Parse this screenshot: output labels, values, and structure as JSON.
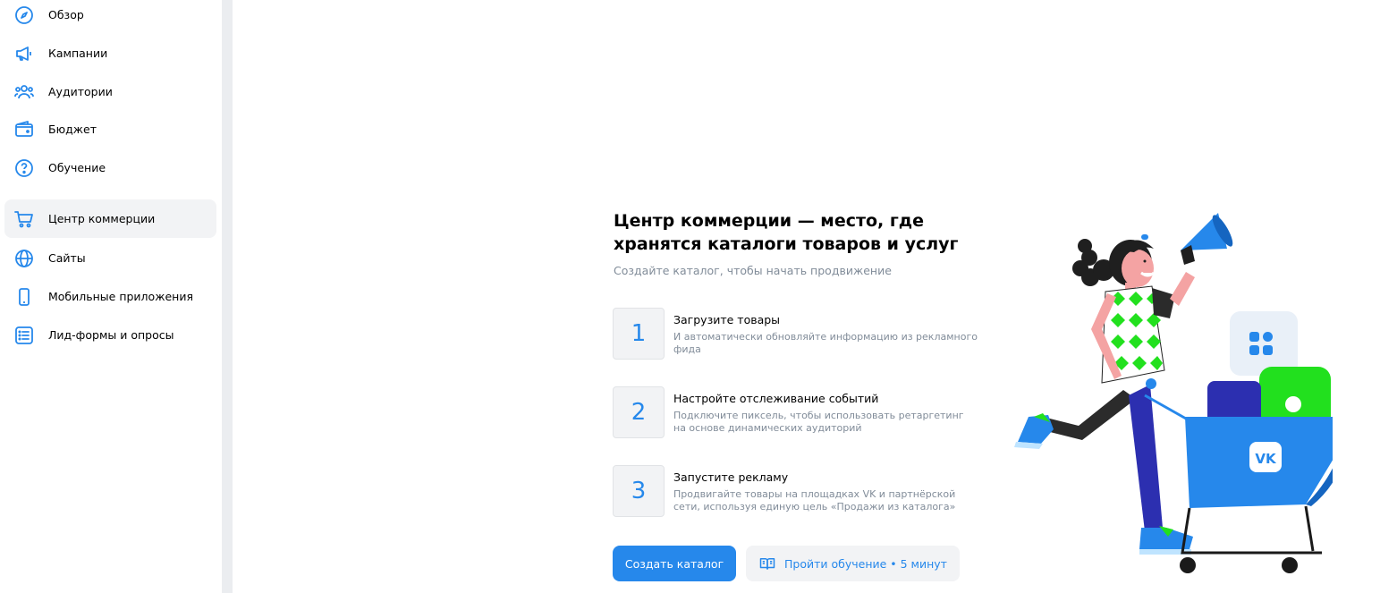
{
  "sidebar": {
    "items": [
      {
        "label": "Обзор",
        "icon": "compass-icon"
      },
      {
        "label": "Кампании",
        "icon": "megaphone-icon"
      },
      {
        "label": "Аудитории",
        "icon": "users-icon"
      },
      {
        "label": "Бюджет",
        "icon": "wallet-icon"
      },
      {
        "label": "Обучение",
        "icon": "question-icon"
      },
      {
        "label": "Центр коммерции",
        "icon": "cart-icon",
        "active": true
      },
      {
        "label": "Сайты",
        "icon": "globe-icon"
      },
      {
        "label": "Мобильные приложения",
        "icon": "phone-icon"
      },
      {
        "label": "Лид-формы и опросы",
        "icon": "list-icon"
      }
    ]
  },
  "main": {
    "headline": "Центр коммерции — место, где хранятся каталоги товаров и услуг",
    "subline": "Создайте каталог, чтобы начать продвижение",
    "steps": [
      {
        "num": "1",
        "title": "Загрузите товары",
        "desc": "И автоматически обновляйте информацию из рекламного фида"
      },
      {
        "num": "2",
        "title": "Настройте отслеживание событий",
        "desc": "Подключите пиксель, чтобы использовать ретаргетинг на основе динамических аудиторий"
      },
      {
        "num": "3",
        "title": "Запустите рекламу",
        "desc": "Продвигайте товары на площадках VK и партнёрской сети, используя единую цель «Продажи из каталога»"
      }
    ],
    "primary_button": "Создать каталог",
    "secondary_button": "Пройти обучение • 5 минут",
    "secondary_icon": "book-icon",
    "illustration_logo": "VK"
  },
  "colors": {
    "accent": "#2688eb",
    "secondary_text": "#818c99",
    "active_bg": "#f2f3f5"
  }
}
